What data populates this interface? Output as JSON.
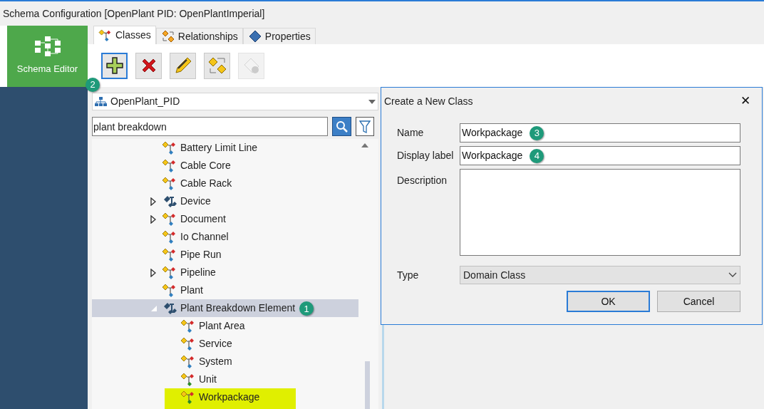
{
  "window": {
    "title": "Schema Configuration [OpenPlant PID: OpenPlantImperial]"
  },
  "sidebar": {
    "items": [
      {
        "label": "Schema Editor",
        "selected": true
      }
    ]
  },
  "tabs": [
    {
      "label": "Classes",
      "selected": true,
      "kind": "classes"
    },
    {
      "label": "Relationships",
      "selected": false,
      "kind": "relationships"
    },
    {
      "label": "Properties",
      "selected": false,
      "kind": "properties"
    }
  ],
  "toolbar": [
    {
      "kind": "add",
      "selected": true,
      "disabled": false
    },
    {
      "kind": "delete",
      "selected": false,
      "disabled": false
    },
    {
      "kind": "edit",
      "selected": false,
      "disabled": false
    },
    {
      "kind": "swap",
      "selected": false,
      "disabled": false
    },
    {
      "kind": "extend",
      "selected": false,
      "disabled": true
    }
  ],
  "toolbar_callout": "2",
  "schema_dropdown": {
    "value": "OpenPlant_PID"
  },
  "search": {
    "value": "plant breakdown"
  },
  "tree": [
    {
      "label": "Battery Limit Line",
      "kind": "class"
    },
    {
      "label": "Cable Core",
      "kind": "class"
    },
    {
      "label": "Cable Rack",
      "kind": "class"
    },
    {
      "label": "Device",
      "kind": "abstract",
      "expanded": false
    },
    {
      "label": "Document",
      "kind": "class",
      "expanded": false
    },
    {
      "label": "Io Channel",
      "kind": "class"
    },
    {
      "label": "Pipe Run",
      "kind": "class"
    },
    {
      "label": "Pipeline",
      "kind": "class",
      "expanded": false
    },
    {
      "label": "Plant",
      "kind": "class"
    },
    {
      "label": "Plant Breakdown Element",
      "kind": "abstract",
      "expanded": true,
      "selected": true,
      "callout": "1",
      "children": [
        {
          "label": "Plant Area",
          "kind": "class"
        },
        {
          "label": "Service",
          "kind": "class"
        },
        {
          "label": "System",
          "kind": "class"
        },
        {
          "label": "Unit",
          "kind": "new"
        },
        {
          "label": "Workpackage",
          "kind": "new",
          "highlighted": true
        }
      ]
    }
  ],
  "dialog": {
    "title": "Create a New Class",
    "close": "✕",
    "fields": [
      {
        "label": "Name",
        "value": "Workpackage",
        "kind": "text",
        "callout": "3"
      },
      {
        "label": "Display label",
        "value": "Workpackage",
        "kind": "text",
        "callout": "4"
      },
      {
        "label": "Description",
        "kind": "textarea"
      },
      {
        "label": "Type",
        "value": "Domain Class",
        "kind": "select"
      }
    ],
    "buttons": [
      {
        "label": "OK",
        "default": true
      },
      {
        "label": "Cancel",
        "default": false
      }
    ]
  }
}
